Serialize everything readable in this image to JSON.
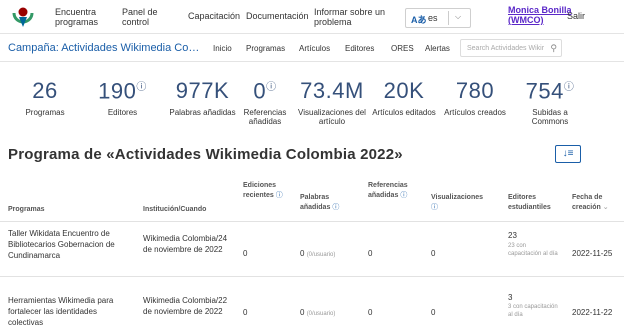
{
  "nav": {
    "items": [
      "Encuentra programas",
      "Panel de control",
      "Capacitación",
      "Documentación",
      "Informar sobre un problema"
    ],
    "language": "es",
    "user": "Monica Bonilla (WMCO)",
    "logout": "Salir",
    "icons": {
      "logo": "wikimedia-logo-icon",
      "lang": "translate-icon",
      "chevron": "chevron-down-icon"
    }
  },
  "campaign": {
    "title": "Campaña: Actividades Wikimedia Co…",
    "tabs": [
      "Inicio",
      "Programas",
      "Artículos",
      "Editores",
      "ORES",
      "Alertas"
    ],
    "search_placeholder": "Search Actividades Wikir",
    "search_icon": "search-icon"
  },
  "stats": [
    {
      "value": "26",
      "label": "Programas",
      "info": ""
    },
    {
      "value": "190",
      "label": "Editores",
      "info": "ⓘ"
    },
    {
      "value": "977K",
      "label": "Palabras añadidas",
      "info": ""
    },
    {
      "value": "0",
      "label": "Referencias añadidas",
      "info": "ⓘ"
    },
    {
      "value": "73.4M",
      "label": "Visualizaciones del artículo",
      "info": ""
    },
    {
      "value": "20K",
      "label": "Artículos editados",
      "info": ""
    },
    {
      "value": "780",
      "label": "Artículos creados",
      "info": ""
    },
    {
      "value": "754",
      "label": "Subidas a Commons",
      "info": "ⓘ"
    }
  ],
  "section": {
    "title": "Programa de «Actividades Wikimedia Colombia 2022»",
    "sort_icon": "sort-icon"
  },
  "table": {
    "headers": {
      "program": "Programas",
      "institution": "Institución/Cuando",
      "recent": "Ediciones recientes",
      "words": "Palabras añadidas",
      "refs": "Referencias añadidas",
      "views": "Visualizaciones",
      "editors": "Editores estudiantiles",
      "date": "Fecha de creación"
    },
    "help": "ⓘ",
    "sort_arrow": "⌄",
    "rows": [
      {
        "program": "Taller Wikidata Encuentro de Bibliotecarios Gobernacion de Cundinamarca",
        "institution": "Wikimedia Colombia/24 de noviembre de 2022",
        "recent": "0",
        "words": "0",
        "words_note": "(0/usuario)",
        "refs": "0",
        "views": "0",
        "editors": "23",
        "editors_note": "23 con capacitación al día",
        "date": "2022-11-25"
      },
      {
        "program": "Herramientas Wikimedia para fortalecer las identidades colectivas",
        "institution": "Wikimedia Colombia/22 de noviembre de 2022",
        "recent": "0",
        "words": "0",
        "words_note": "(0/usuario)",
        "refs": "0",
        "views": "0",
        "editors": "3",
        "editors_note": "3 con capacitación al día",
        "date": "2022-11-22"
      }
    ]
  }
}
